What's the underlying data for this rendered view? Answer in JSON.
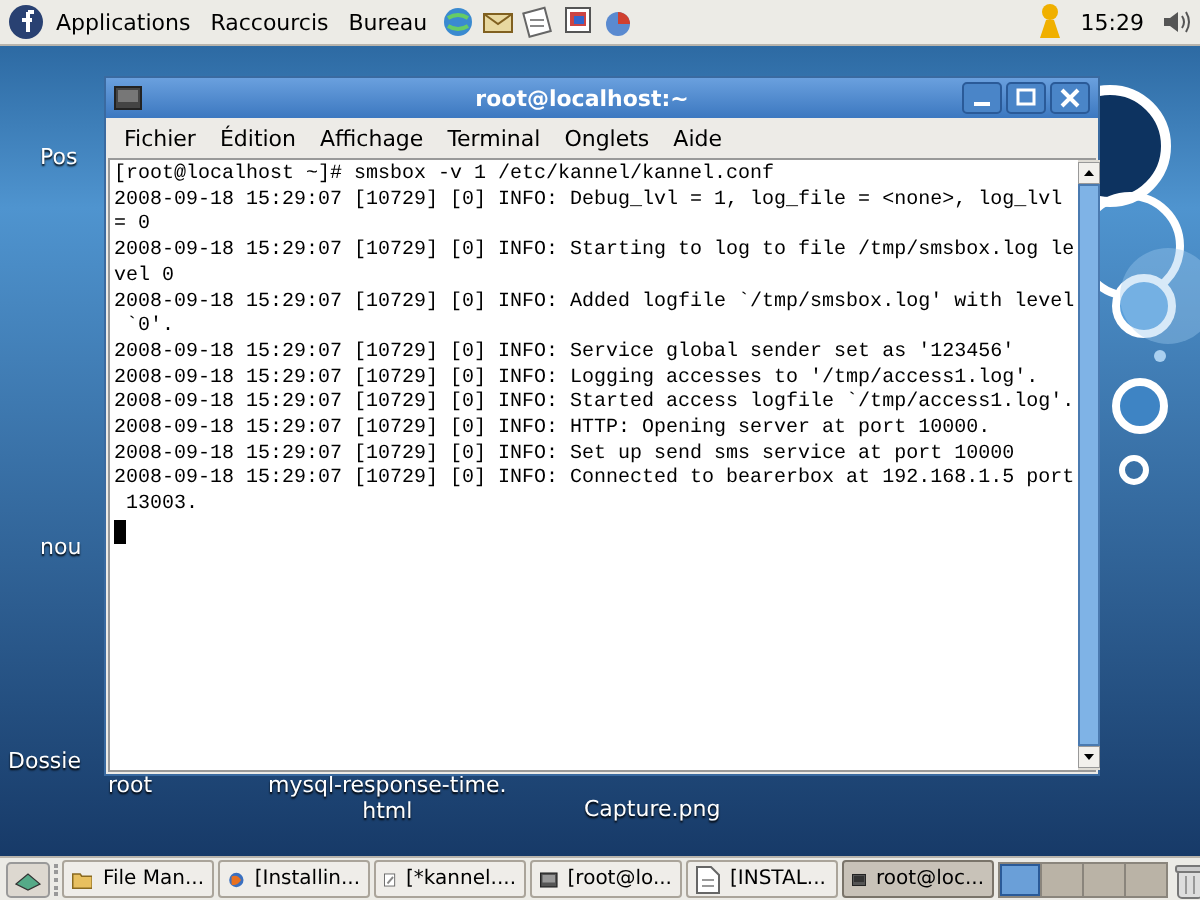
{
  "top_panel": {
    "menus": [
      "Applications",
      "Raccourcis",
      "Bureau"
    ],
    "clock": "15:29"
  },
  "desktop_icons": [
    {
      "lines": [
        "Pos"
      ]
    },
    {
      "lines": [
        "nou"
      ]
    },
    {
      "lines": [
        "Dossie"
      ]
    },
    {
      "lines": [
        "root"
      ]
    },
    {
      "lines": [
        "mysql-response-time.",
        "html"
      ]
    },
    {
      "lines": [
        "Capture.png"
      ]
    }
  ],
  "window": {
    "title": "root@localhost:~",
    "menu": [
      "Fichier",
      "Édition",
      "Affichage",
      "Terminal",
      "Onglets",
      "Aide"
    ],
    "terminal_lines": [
      "[root@localhost ~]# smsbox -v 1 /etc/kannel/kannel.conf",
      "2008-09-18 15:29:07 [10729] [0] INFO: Debug_lvl = 1, log_file = <none>, log_lvl",
      "= 0",
      "2008-09-18 15:29:07 [10729] [0] INFO: Starting to log to file /tmp/smsbox.log le",
      "vel 0",
      "2008-09-18 15:29:07 [10729] [0] INFO: Added logfile `/tmp/smsbox.log' with level",
      " `0'.",
      "2008-09-18 15:29:07 [10729] [0] INFO: Service global sender set as '123456'",
      "2008-09-18 15:29:07 [10729] [0] INFO: Logging accesses to '/tmp/access1.log'.",
      "2008-09-18 15:29:07 [10729] [0] INFO: Started access logfile `/tmp/access1.log'.",
      "2008-09-18 15:29:07 [10729] [0] INFO: HTTP: Opening server at port 10000.",
      "2008-09-18 15:29:07 [10729] [0] INFO: Set up send sms service at port 10000",
      "2008-09-18 15:29:07 [10729] [0] INFO: Connected to bearerbox at 192.168.1.5 port",
      " 13003."
    ]
  },
  "taskbar": {
    "tasks": [
      {
        "kind": "folder",
        "label": "File Man...",
        "selected": false
      },
      {
        "kind": "browser",
        "label": "[Installin...",
        "selected": false
      },
      {
        "kind": "editor",
        "label": "[*kannel....",
        "selected": false
      },
      {
        "kind": "terminal",
        "label": "[root@lo...",
        "selected": false
      },
      {
        "kind": "document",
        "label": "[INSTAL...",
        "selected": false
      },
      {
        "kind": "terminal",
        "label": "root@loc...",
        "selected": true
      }
    ],
    "workspaces": [
      {
        "selected": true
      },
      {
        "selected": false
      },
      {
        "selected": false
      },
      {
        "selected": false
      }
    ]
  }
}
